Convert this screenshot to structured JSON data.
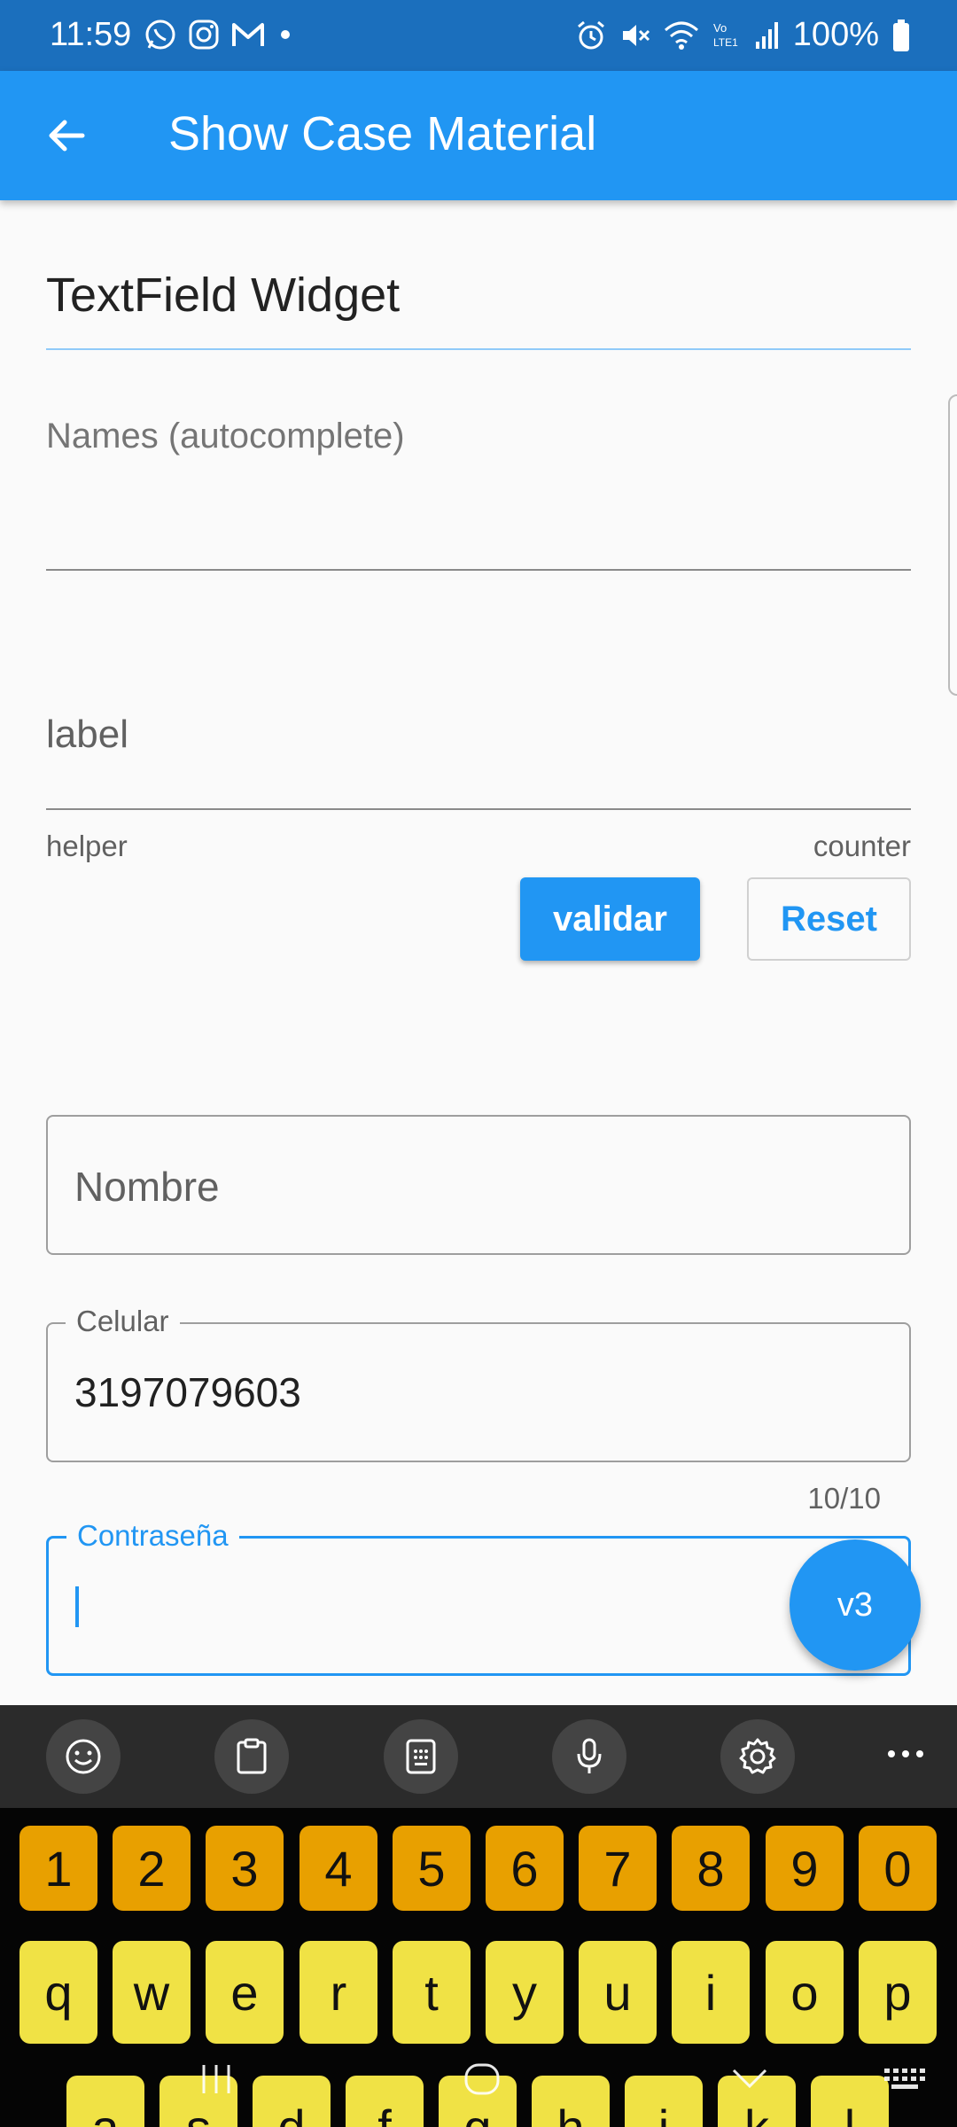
{
  "status_bar": {
    "time": "11:59",
    "battery": "100%",
    "left_icons": [
      "whatsapp-icon",
      "instagram-icon",
      "gmail-icon",
      "dot-icon"
    ],
    "right_icons": [
      "alarm-icon",
      "mute-icon",
      "wifi-icon",
      "volte-icon",
      "signal-icon",
      "battery-icon"
    ]
  },
  "app_bar": {
    "title": "Show Case Material",
    "back_icon": "arrow-left-icon"
  },
  "content": {
    "section_title": "TextField Widget",
    "names_field": {
      "label": "Names (autocomplete)"
    },
    "label_field": {
      "label": "label",
      "helper": "helper",
      "counter": "counter"
    },
    "buttons": {
      "validar": "validar",
      "reset": "Reset"
    },
    "nombre_field": {
      "placeholder": "Nombre"
    },
    "celular_field": {
      "label": "Celular",
      "value": "3197079603",
      "counter": "10/10"
    },
    "password_field": {
      "label": "Contraseña",
      "value": ""
    },
    "fab": {
      "label": "v3"
    }
  },
  "keyboard": {
    "toolbar": [
      "emoji-icon",
      "clipboard-icon",
      "keypad-icon",
      "microphone-icon",
      "settings-icon",
      "more-icon"
    ],
    "number_row": [
      "1",
      "2",
      "3",
      "4",
      "5",
      "6",
      "7",
      "8",
      "9",
      "0"
    ],
    "letter_row_1": [
      "q",
      "w",
      "e",
      "r",
      "t",
      "y",
      "u",
      "i",
      "o",
      "p"
    ],
    "letter_row_2": [
      "a",
      "s",
      "d",
      "f",
      "g",
      "h",
      "j",
      "k",
      "l"
    ]
  },
  "colors": {
    "primary": "#2196f3",
    "status_bar": "#1b6fbd",
    "number_keys": "#e8a000",
    "letter_keys": "#f0e245"
  }
}
